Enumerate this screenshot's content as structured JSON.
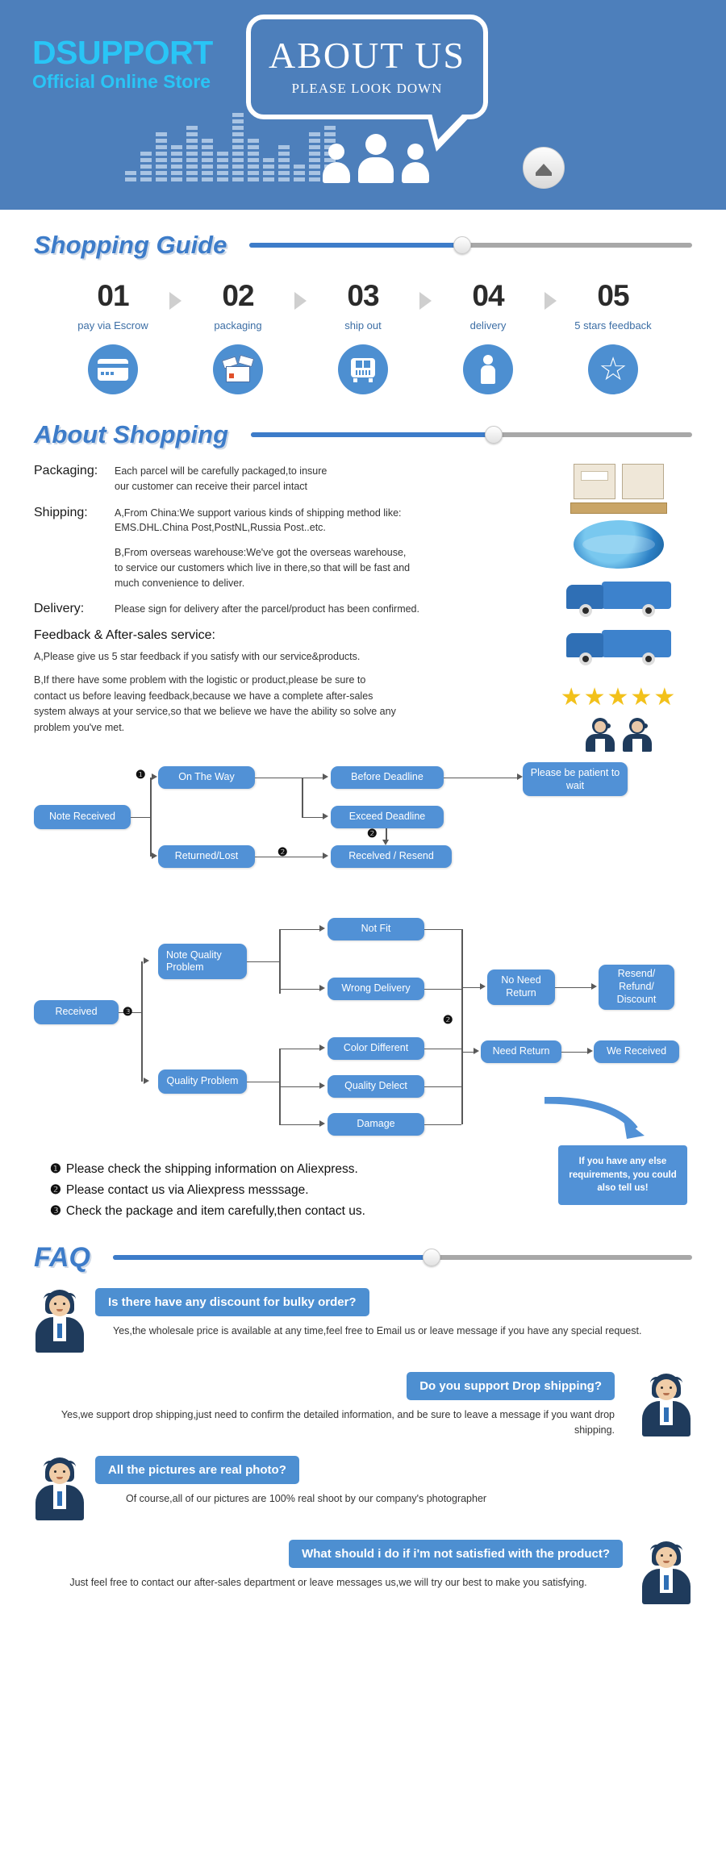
{
  "header": {
    "brand_name": "DSUPPORT",
    "brand_sub": "Official Online Store",
    "bubble_title": "ABOUT US",
    "bubble_sub": "PLEASE LOOK DOWN",
    "eject_icon": "eject-icon",
    "accent_blue": "#4d7fbb",
    "cyan": "#29c5f6"
  },
  "shopping_guide": {
    "title": "Shopping Guide",
    "slider_percent": 48,
    "steps": [
      {
        "num": "01",
        "label": "pay via Escrow",
        "icon": "credit-card-icon"
      },
      {
        "num": "02",
        "label": "packaging",
        "icon": "open-box-icon"
      },
      {
        "num": "03",
        "label": "ship out",
        "icon": "bus-icon"
      },
      {
        "num": "04",
        "label": "delivery",
        "icon": "delivery-person-icon"
      },
      {
        "num": "05",
        "label": "5 stars feedback",
        "icon": "star-icon"
      }
    ]
  },
  "about_shopping": {
    "title": "About Shopping",
    "slider_percent": 55,
    "rows": [
      {
        "label": "Packaging:",
        "lines": [
          "Each parcel will be carefully packaged,to insure",
          "our customer can receive their parcel intact"
        ]
      },
      {
        "label": "Shipping:",
        "lines": [
          "A,From China:We support various kinds of shipping method like:",
          "EMS.DHL.China Post,PostNL,Russia Post..etc."
        ],
        "lines2": [
          "B,From overseas warehouse:We've got the overseas warehouse,",
          "to service our customers which live in there,so that will be fast and",
          "much convenience to deliver."
        ]
      },
      {
        "label": "Delivery:",
        "lines": [
          "Please sign for delivery after the parcel/product has been confirmed."
        ]
      }
    ],
    "feedback_title": "Feedback & After-sales service:",
    "feedback_a": "A,Please give us 5 star feedback if you satisfy with our service&products.",
    "feedback_b": "B,If there have some problem with the logistic or product,please be sure to contact us before leaving feedback,because we have a complete after-sales system always at your service,so that we believe we have the ability so solve any problem you've met.",
    "side_images": [
      "packed-parcels-icon",
      "globe-shipping-icon",
      "blue-van-icon",
      "blue-truck-icon",
      "five-stars-icon",
      "support-agents-icon"
    ],
    "stars": "★★★★★"
  },
  "flow1": {
    "nodes": {
      "note_received": "Note Received",
      "on_the_way": "On The Way",
      "returned_lost": "Returned/Lost",
      "before_deadline": "Before Deadline",
      "exceed_deadline": "Exceed Deadline",
      "received_resend": "Recelved / Resend",
      "please_be_patient": "Please be patient to wait"
    },
    "markers": {
      "m1": "❶",
      "m2a": "❷",
      "m2b": "❷"
    }
  },
  "flow2": {
    "nodes": {
      "received": "Received",
      "note_quality_problem": "Note Quality Problem",
      "quality_problem": "Quality Problem",
      "not_fit": "Not Fit",
      "wrong_delivery": "Wrong Delivery",
      "color_different": "Color Different",
      "quality_delect": "Quality Delect",
      "damage": "Damage",
      "no_need_return": "No Need Return",
      "need_return": "Need Return",
      "resend_refund_discount": "Resend/ Refund/ Discount",
      "we_received": "We Received"
    },
    "markers": {
      "m3": "❸",
      "m2": "❷"
    }
  },
  "notes": {
    "items": [
      {
        "bullet": "❶",
        "text": "Please check the shipping information on Aliexpress."
      },
      {
        "bullet": "❷",
        "text": "Please contact us via Aliexpress messsage."
      },
      {
        "bullet": "❸",
        "text": "Check the package and item carefully,then contact us."
      }
    ],
    "callout": "If you have any else requirements, you could also tell us!"
  },
  "faq": {
    "title": "FAQ",
    "slider_percent": 55,
    "items": [
      {
        "question": "Is there have any discount for bulky order?",
        "answer": "Yes,the wholesale price is available at any time,feel free to Email us or leave message if you have any special request.",
        "avatar": "support-agent-avatar",
        "side": "left"
      },
      {
        "question": "Do you support Drop shipping?",
        "answer": "Yes,we support drop shipping,just need to confirm the detailed information, and be sure to leave a message if you want drop shipping.",
        "avatar": "support-agent-avatar",
        "side": "right"
      },
      {
        "question": "All the pictures are real photo?",
        "answer": "Of course,all of our pictures are 100% real shoot by our company's photographer",
        "avatar": "support-agent-avatar",
        "side": "left"
      },
      {
        "question": "What should i do if i'm not satisfied with the product?",
        "answer": "Just feel free to contact our after-sales department or leave messages us,we will try our best to make you satisfying.",
        "avatar": "support-agent-avatar",
        "side": "right"
      }
    ]
  }
}
